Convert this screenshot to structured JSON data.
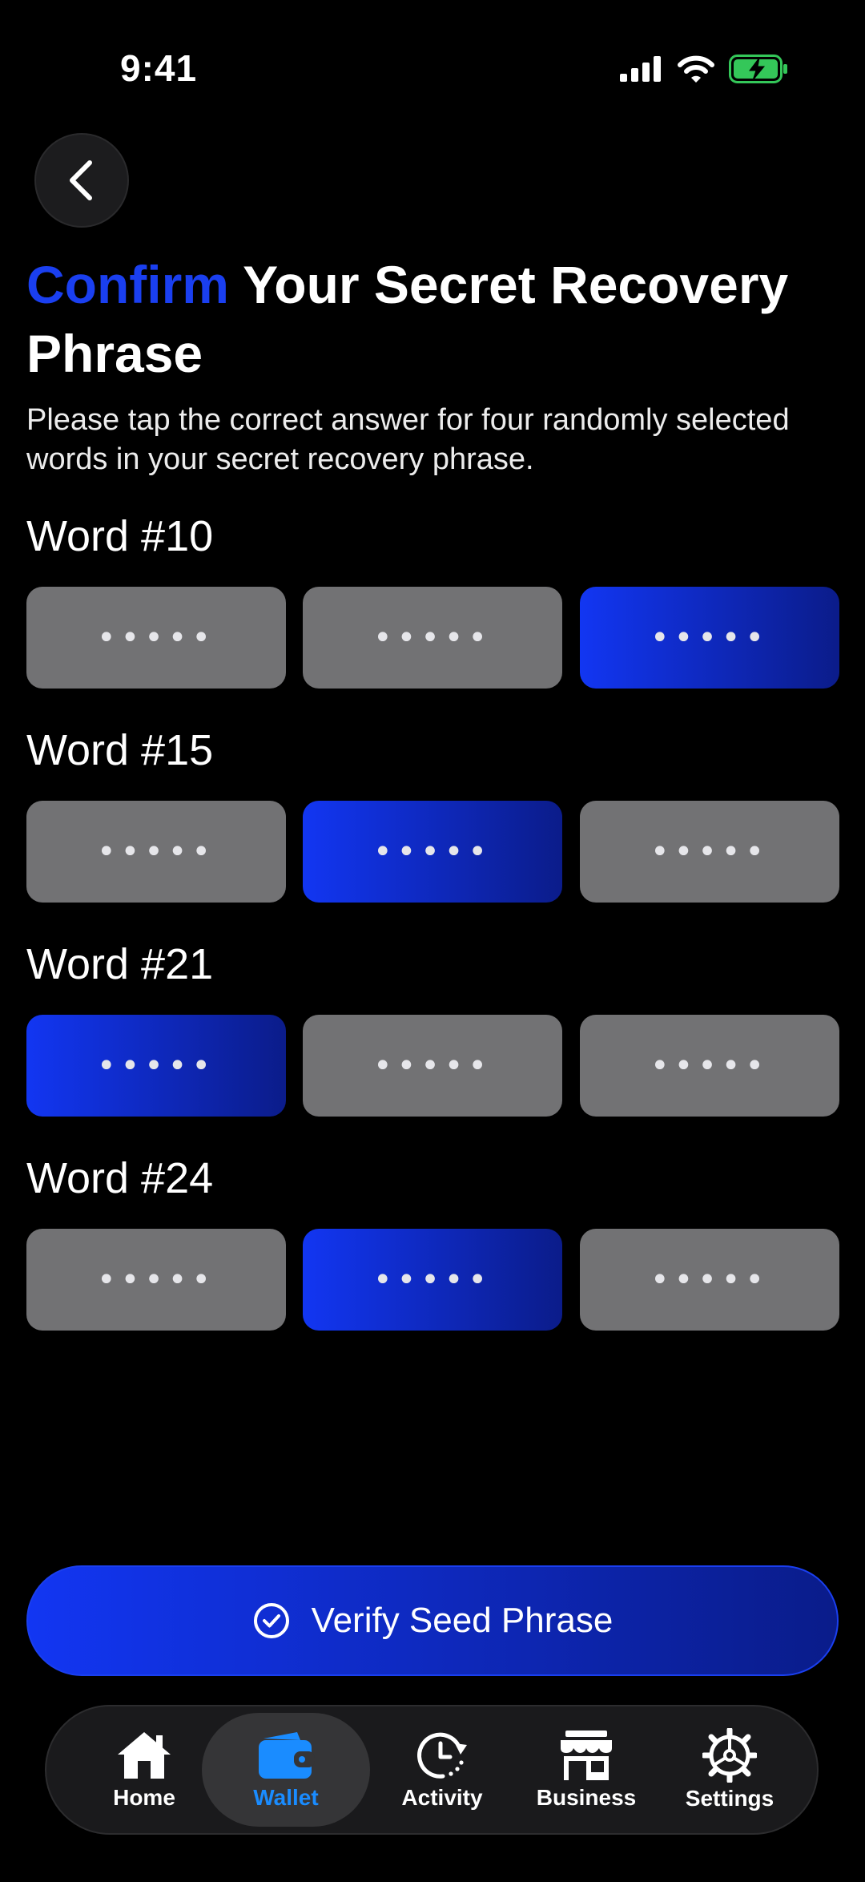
{
  "status_bar": {
    "time": "9:41"
  },
  "header": {
    "title_accent": "Confirm",
    "title_rest": " Your Secret Recovery Phrase",
    "subtitle": "Please tap the correct answer for four randomly selected words in your secret recovery phrase."
  },
  "word_groups": [
    {
      "label": "Word #10",
      "options": [
        "•••••",
        "•••••",
        "•••••"
      ],
      "selected_index": 2
    },
    {
      "label": "Word #15",
      "options": [
        "•••••",
        "•••••",
        "•••••"
      ],
      "selected_index": 1
    },
    {
      "label": "Word #21",
      "options": [
        "•••••",
        "•••••",
        "•••••"
      ],
      "selected_index": 0
    },
    {
      "label": "Word #24",
      "options": [
        "•••••",
        "•••••",
        "•••••"
      ],
      "selected_index": 1
    }
  ],
  "verify_button": {
    "label": "Verify Seed Phrase"
  },
  "tab_bar": {
    "items": [
      {
        "label": "Home",
        "icon": "home-icon"
      },
      {
        "label": "Wallet",
        "icon": "wallet-icon"
      },
      {
        "label": "Activity",
        "icon": "clock-icon"
      },
      {
        "label": "Business",
        "icon": "store-icon"
      },
      {
        "label": "Settings",
        "icon": "gear-icon"
      }
    ],
    "active": "Wallet"
  },
  "colors": {
    "accent": "#1a3ff0",
    "option_idle": "#727274",
    "active_tab_label": "#1a8cff",
    "battery": "#34c759"
  }
}
